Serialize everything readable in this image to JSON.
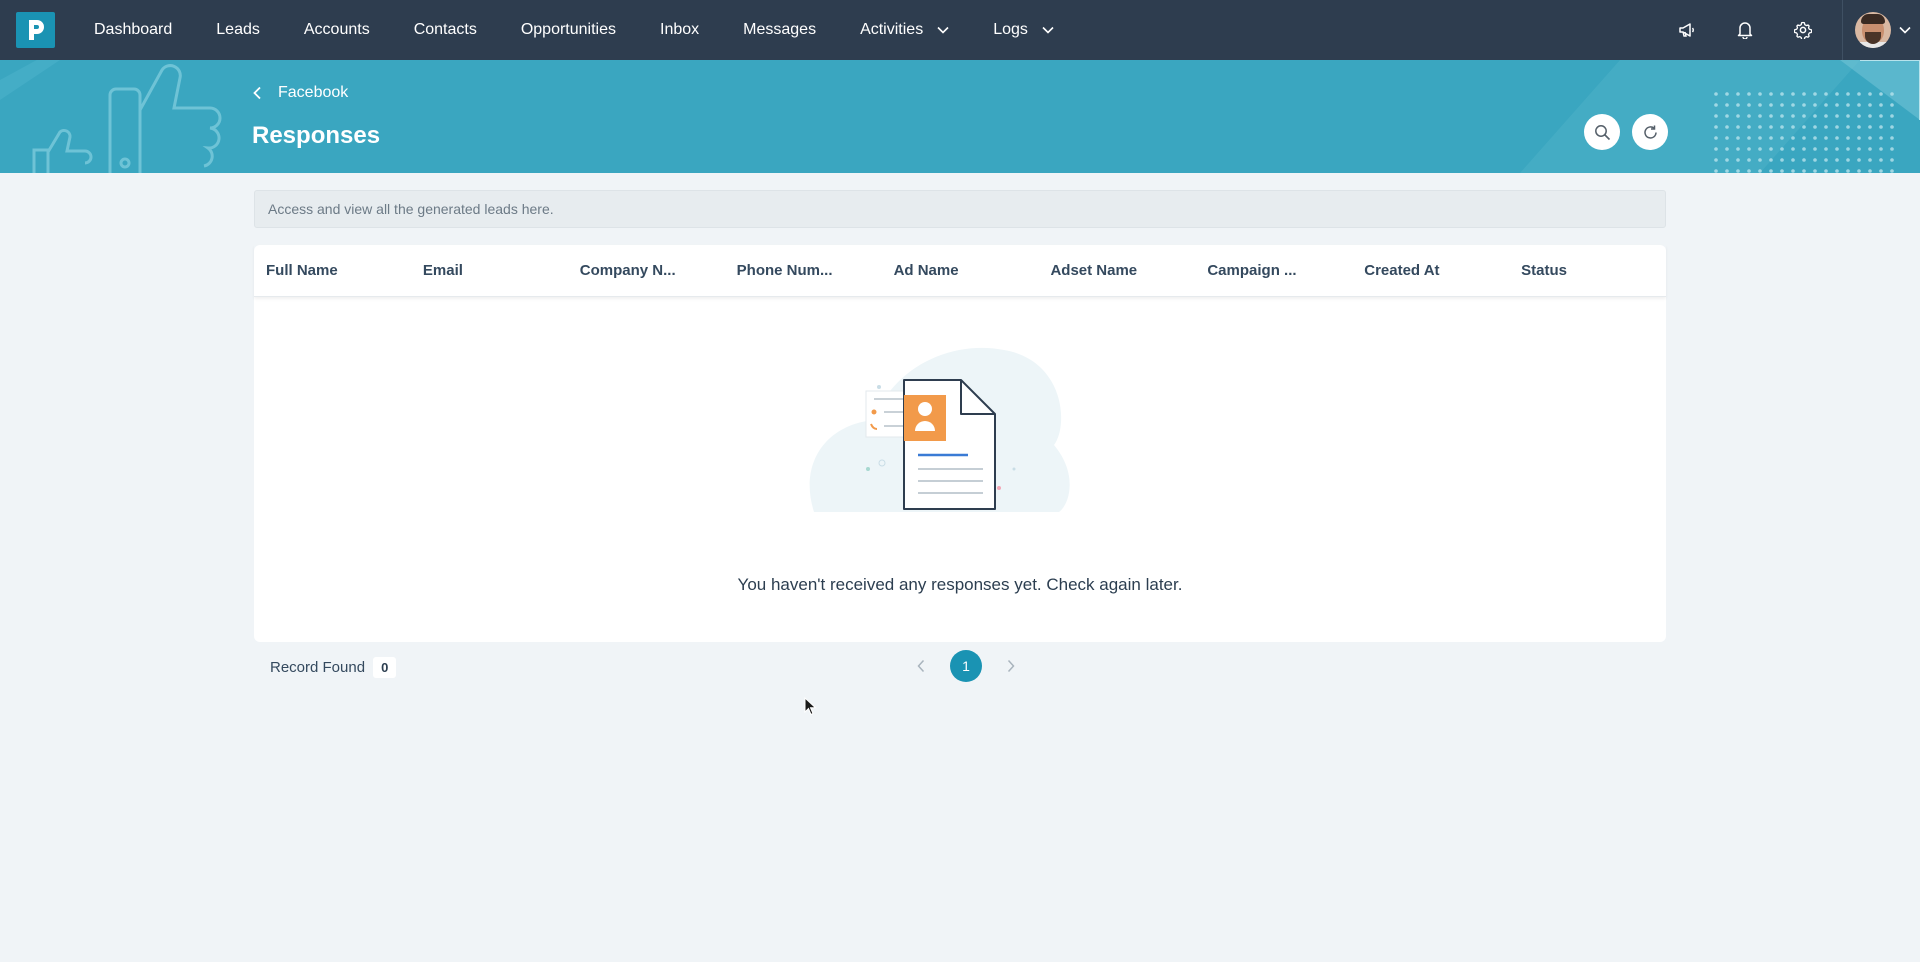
{
  "nav": {
    "items": [
      {
        "label": "Dashboard"
      },
      {
        "label": "Leads"
      },
      {
        "label": "Accounts"
      },
      {
        "label": "Contacts"
      },
      {
        "label": "Opportunities"
      },
      {
        "label": "Inbox"
      },
      {
        "label": "Messages"
      },
      {
        "label": "Activities"
      },
      {
        "label": "Logs"
      }
    ]
  },
  "header": {
    "breadcrumb": "Facebook",
    "title": "Responses"
  },
  "info": "Access and view all the generated leads here.",
  "table": {
    "columns": [
      "Full Name",
      "Email",
      "Company N...",
      "Phone Num...",
      "Ad Name",
      "Adset Name",
      "Campaign ...",
      "Created At",
      "Status"
    ],
    "rows": [],
    "empty_message": "You haven't received any responses yet. Check again later."
  },
  "footer": {
    "record_label": "Record Found",
    "record_count": "0",
    "current_page": "1"
  },
  "colors": {
    "topbar": "#2e3d4f",
    "banner": "#3aa6c0",
    "accent": "#1a93b3",
    "illustration_orange": "#f29a4a"
  },
  "icons": [
    "logo-icon",
    "back-chevron-icon",
    "megaphone-icon",
    "bell-icon",
    "gear-icon",
    "search-icon",
    "refresh-icon",
    "chevron-down-icon",
    "chevron-left-icon",
    "chevron-right-icon"
  ]
}
